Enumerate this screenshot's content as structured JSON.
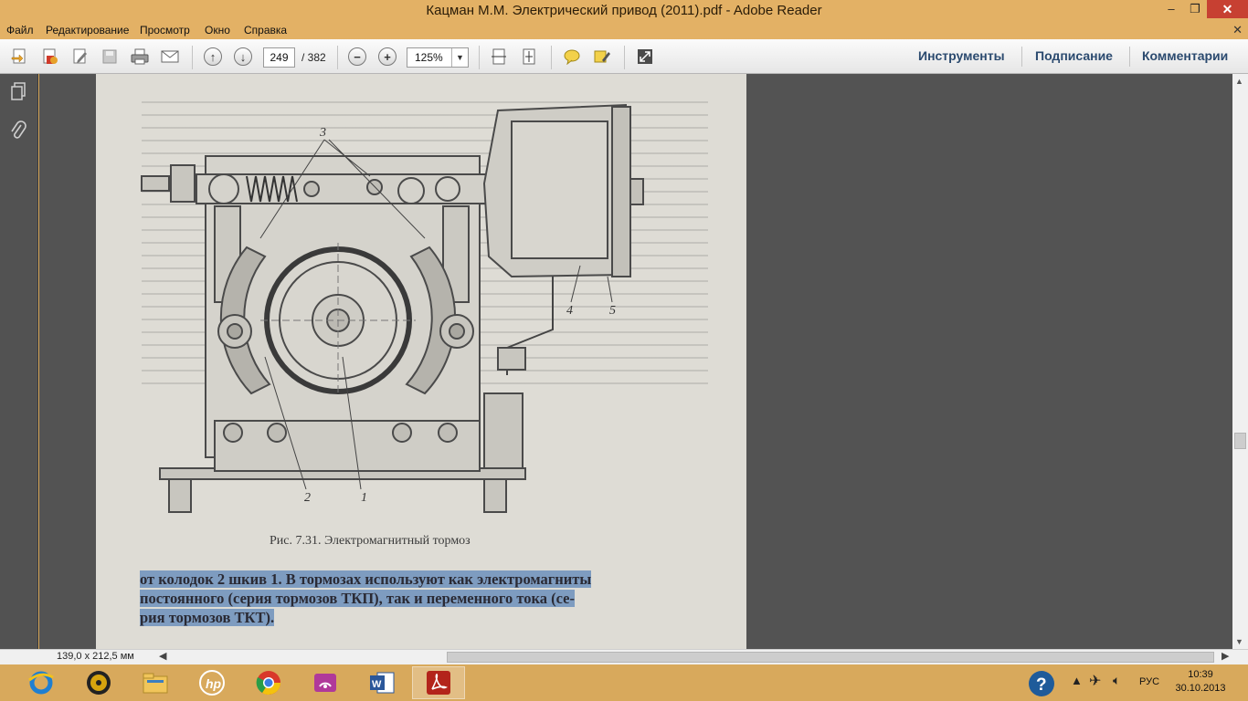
{
  "window": {
    "title": "Кацман М.М. Электрический привод (2011).pdf - Adobe Reader",
    "minimize": "–",
    "maximize": "❐",
    "close": "✕"
  },
  "menu": {
    "items": [
      "Файл",
      "Редактирование",
      "Просмотр",
      "Окно",
      "Справка"
    ],
    "close": "✕"
  },
  "toolbar": {
    "page_current": "249",
    "page_total": "/ 382",
    "zoom": "125%",
    "right_tabs": [
      "Инструменты",
      "Подписание",
      "Комментарии"
    ]
  },
  "document": {
    "figure_labels": [
      "3",
      "4",
      "5",
      "2",
      "1"
    ],
    "caption": "Рис. 7.31. Электромагнитный тормоз",
    "body_lines": [
      "от колодок 2 шкив 1. В тормозах используют как электромагниты",
      "постоянного (серия тормозов ТКП), так и переменного тока (се-",
      "рия тормозов ТКТ)."
    ]
  },
  "status": {
    "page_size": "139,0 x 212,5 мм"
  },
  "taskbar": {
    "language": "РУС",
    "time": "10:39",
    "date": "30.10.2013"
  },
  "colors": {
    "accent": "#e3b165",
    "selection": "#7e9cc0",
    "tab_text": "#2b4a6f"
  }
}
